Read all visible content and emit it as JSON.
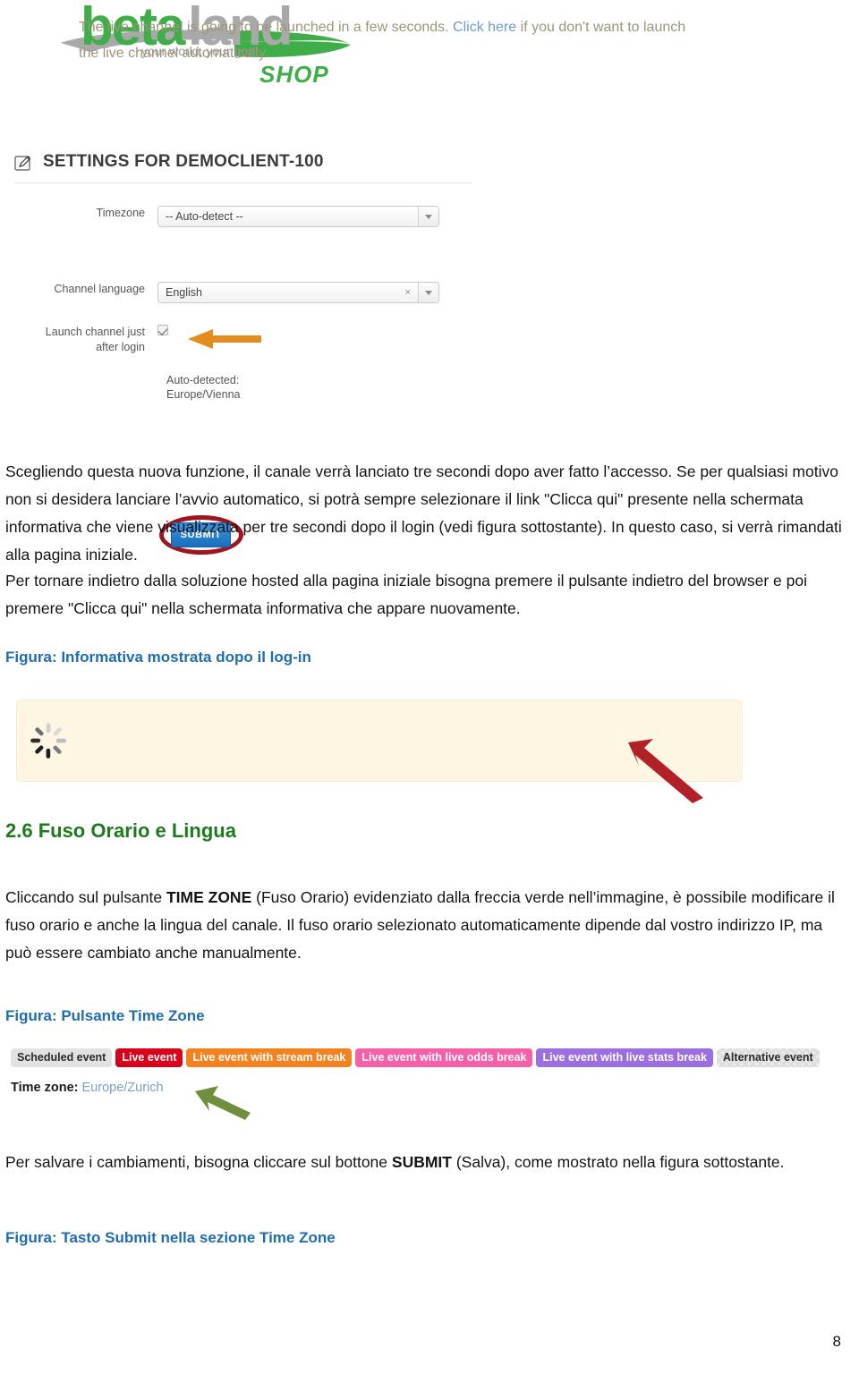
{
  "logo": {
    "word_part1": "beta",
    "word_part2": "land",
    "tagline": "your world, your goal",
    "sub_brand": "SHOP",
    "green": "#3fae49",
    "gray": "#a9a9a9"
  },
  "settings_panel": {
    "edit_icon": "edit-pencil-icon",
    "title": "SETTINGS FOR DEMOCLIENT-100",
    "rows": [
      {
        "label": "Timezone",
        "value": "-- Auto-detect --",
        "has_clear": false
      },
      {
        "label": "Channel language",
        "value": "English",
        "has_clear": true,
        "clear_glyph": "×"
      }
    ],
    "auto_detected_label": "Auto-detected:",
    "auto_detected_value": "Europe/Vienna",
    "checkbox_label_line1": "Launch channel just",
    "checkbox_label_line2": "after login",
    "checkbox_checked": true,
    "submit_label": "SUBMIT",
    "annotation_arrow_color": "#e58c1e",
    "annotation_ellipse_color": "#9d1521"
  },
  "body": {
    "paragraph1": "Scegliendo questa nuova funzione, il canale verrà lanciato tre secondi dopo aver fatto l’accesso. Se per qualsiasi motivo non si desidera lanciare l’avvio automatico, si potrà sempre selezionare il link \"Clicca qui\" presente nella schermata informativa che viene visualizzata per tre secondi dopo il login (vedi figura sottostante). In questo caso, si verrà rimandati alla pagina iniziale.",
    "paragraph2": "Per tornare indietro dalla soluzione hosted alla pagina iniziale bisogna premere il pulsante indietro del browser e poi premere \"Clicca qui\" nella schermata informativa che appare nuovamente.",
    "figure_caption_1": "Figura: Informativa mostrata dopo il log-in",
    "section_heading": "2.6 Fuso Orario e Lingua",
    "paragraph3_a": "Cliccando sul pulsante ",
    "paragraph3_bold": "TIME ZONE",
    "paragraph3_b": " (Fuso Orario) evidenziato dalla freccia verde nell’immagine, è possibile modificare il fuso orario e anche la lingua del canale. Il fuso orario selezionato automaticamente dipende dal vostro indirizzo IP, ma può essere cambiato anche manualmente.",
    "figure_caption_2": "Figura: Pulsante Time Zone",
    "paragraph4_a": "Per salvare i cambiamenti, bisogna cliccare sul bottone ",
    "paragraph4_bold": "SUBMIT",
    "paragraph4_b": " (Salva), come mostrato nella figura sottostante.",
    "figure_caption_3": "Figura: Tasto Submit nella sezione Time Zone",
    "page_number": "8"
  },
  "info_box": {
    "spinner_icon": "loading-spinner-icon",
    "text_a": "The live channel is going to be launched in a few seconds. ",
    "link_text": "Click here",
    "text_b": " if you don't want to launch the live channel automatically.",
    "background": "#fdf6e3",
    "arrow_color": "#b22127"
  },
  "tagbar": {
    "tags": [
      {
        "label": "Scheduled event",
        "bg": "#e2e2e2",
        "fg": "#2a2a2a",
        "pattern": false
      },
      {
        "label": "Live event",
        "bg": "#d9001b",
        "fg": "#ffffff",
        "pattern": false
      },
      {
        "label": "Live event with stream break",
        "bg": "#f58220",
        "fg": "#ffffff",
        "pattern": false
      },
      {
        "label": "Live event with live odds break",
        "bg": "#f560a8",
        "fg": "#ffffff",
        "pattern": false
      },
      {
        "label": "Live event with live stats break",
        "bg": "#9b6fe0",
        "fg": "#ffffff",
        "pattern": false
      },
      {
        "label": "Alternative event",
        "bg": "#e8e8e8",
        "fg": "#2a2a2a",
        "pattern": true
      }
    ],
    "timezone_label": "Time zone",
    "timezone_separator": ": ",
    "timezone_value": "Europe/Zurich",
    "arrow_color": "#6f8f3e"
  }
}
